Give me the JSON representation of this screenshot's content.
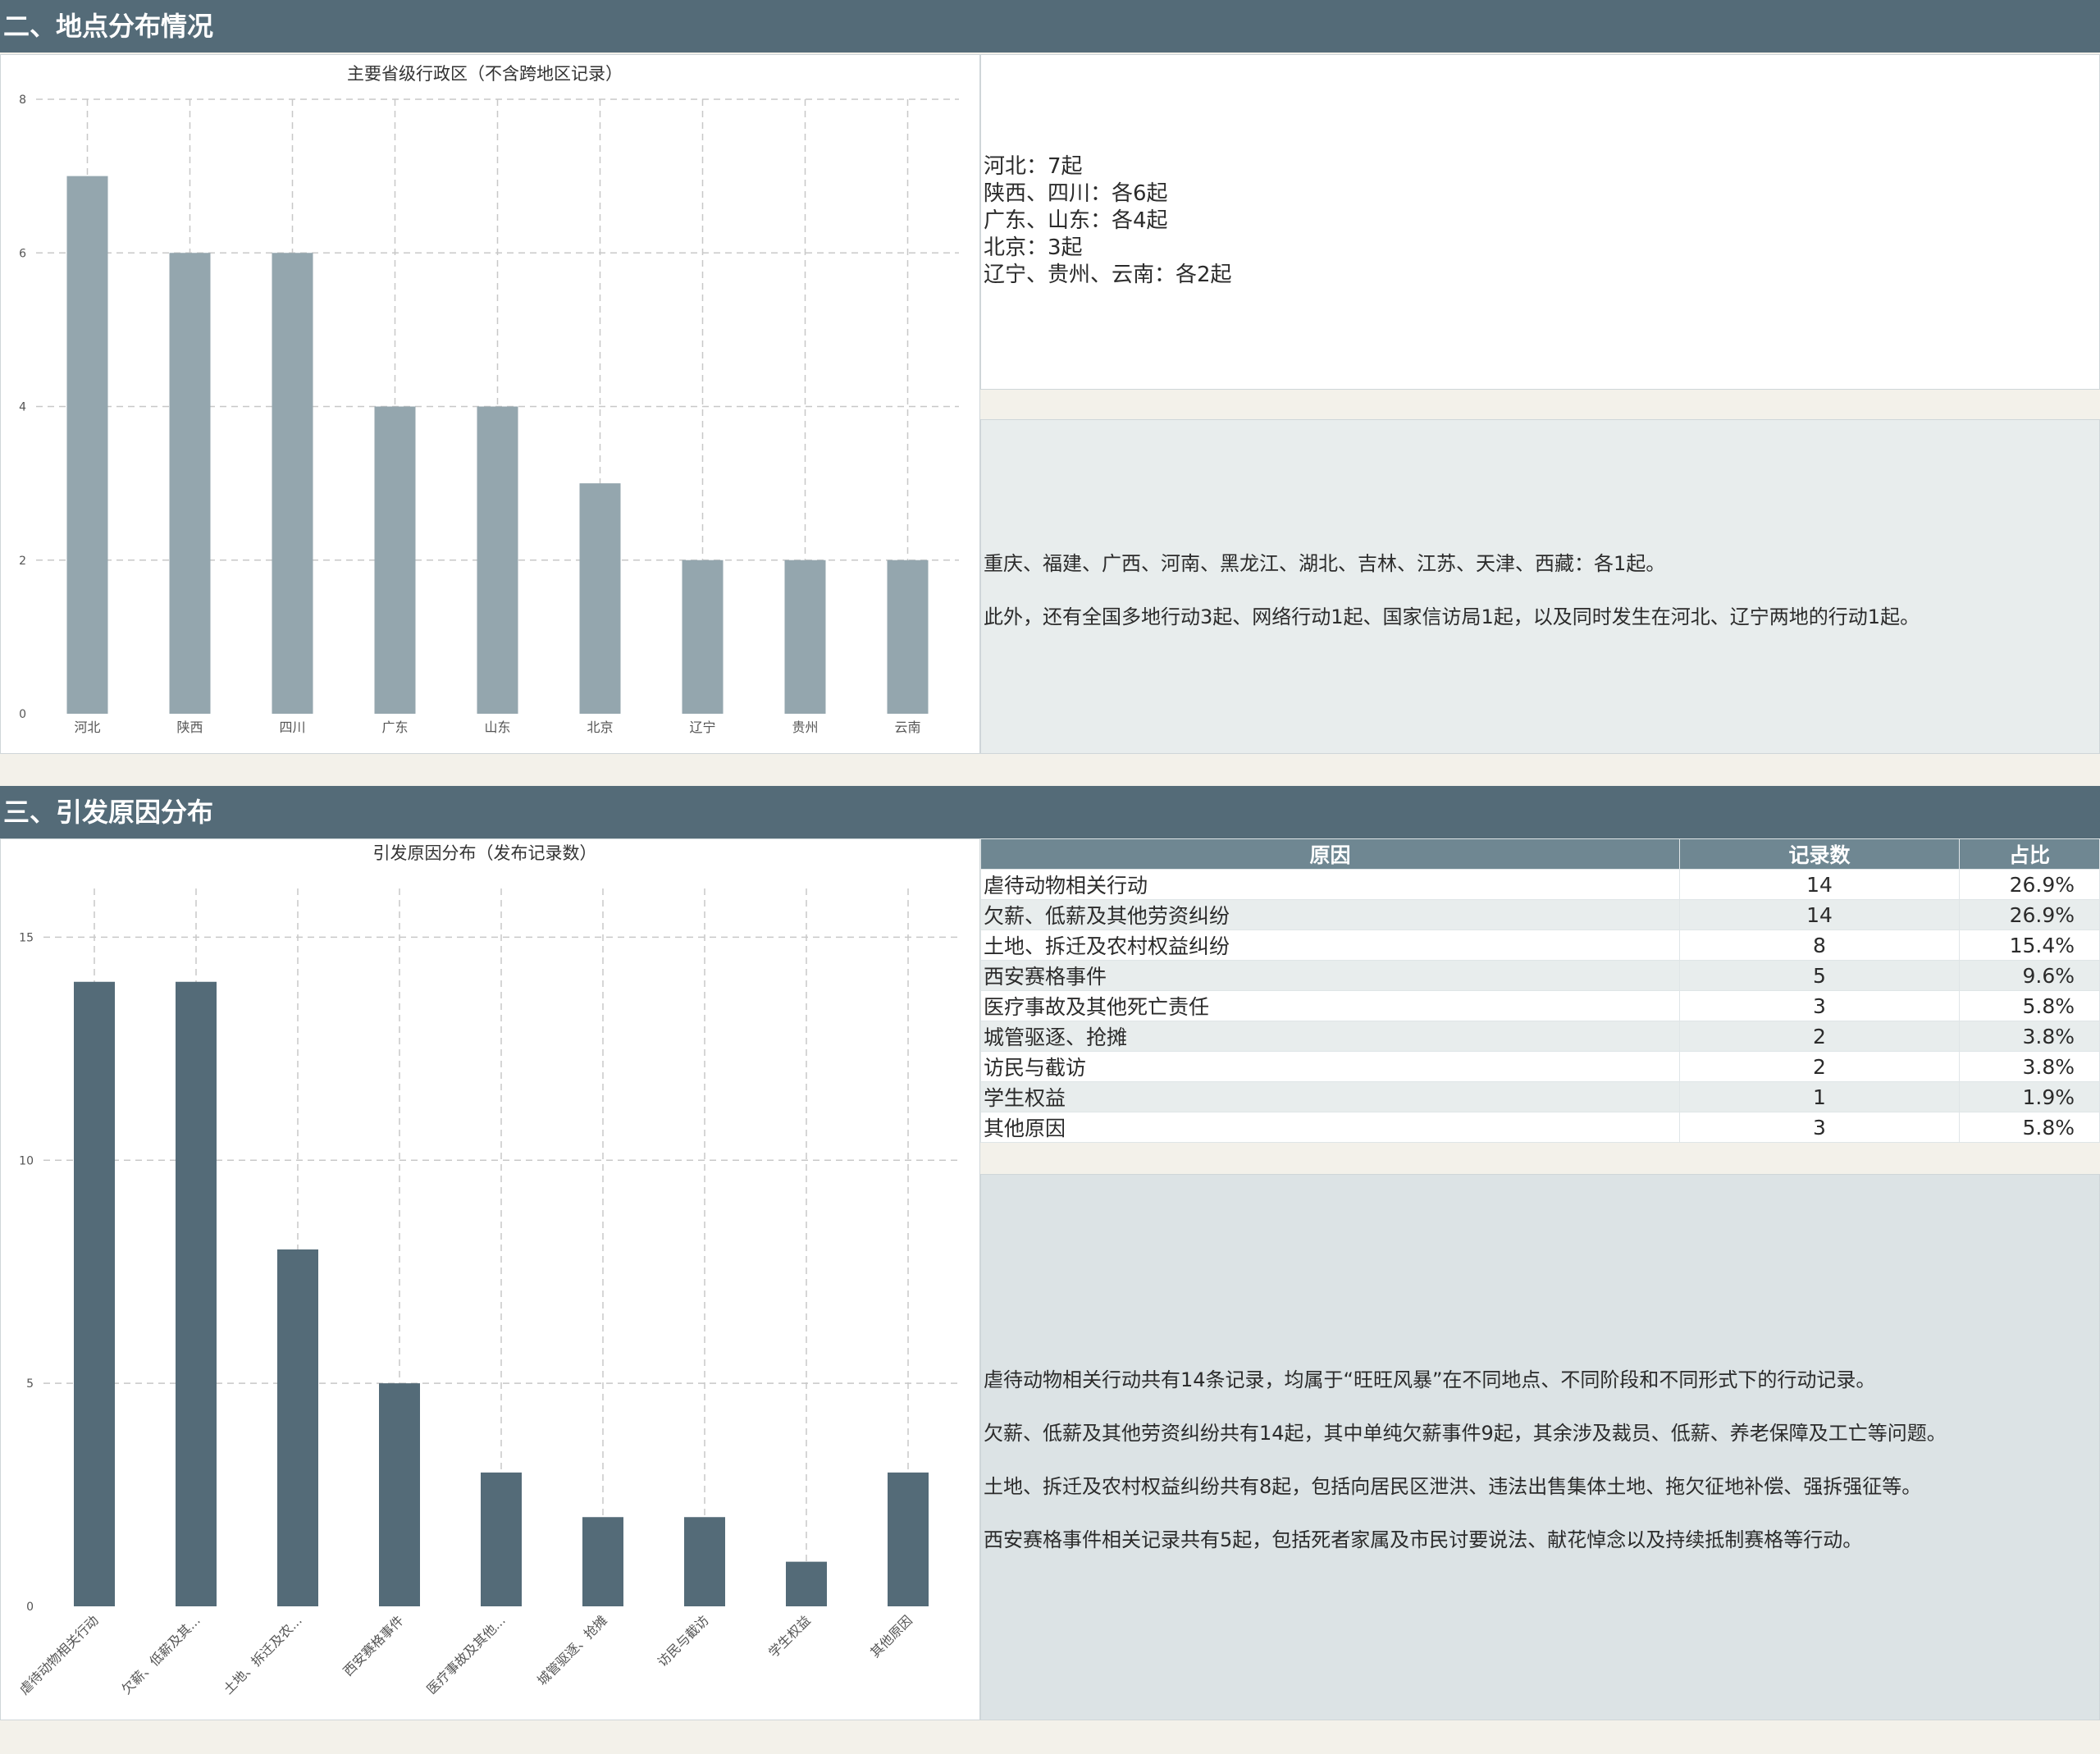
{
  "section2": {
    "title": "二、地点分布情况"
  },
  "section3": {
    "title": "三、引发原因分布"
  },
  "province_summary": [
    "河北：7起",
    "陕西、四川：各6起",
    "广东、山东：各4起",
    "北京：3起",
    "辽宁、贵州、云南：各2起"
  ],
  "province_notes": [
    "重庆、福建、广西、河南、黑龙江、湖北、吉林、江苏、天津、西藏：各1起。",
    "此外，还有全国多地行动3起、网络行动1起、国家信访局1起，以及同时发生在河北、辽宁两地的行动1起。"
  ],
  "cause_table": {
    "headers": [
      "原因",
      "记录数",
      "占比"
    ],
    "rows": [
      [
        "虐待动物相关行动",
        "14",
        "26.9%"
      ],
      [
        "欠薪、低薪及其他劳资纠纷",
        "14",
        "26.9%"
      ],
      [
        "土地、拆迁及农村权益纠纷",
        "8",
        "15.4%"
      ],
      [
        "西安赛格事件",
        "5",
        "9.6%"
      ],
      [
        "医疗事故及其他死亡责任",
        "3",
        "5.8%"
      ],
      [
        "城管驱逐、抢摊",
        "2",
        "3.8%"
      ],
      [
        "访民与截访",
        "2",
        "3.8%"
      ],
      [
        "学生权益",
        "1",
        "1.9%"
      ],
      [
        "其他原因",
        "3",
        "5.8%"
      ]
    ]
  },
  "cause_notes": [
    "虐待动物相关行动共有14条记录，均属于“旺旺风暴”在不同地点、不同阶段和不同形式下的行动记录。",
    "欠薪、低薪及其他劳资纠纷共有14起，其中单纯欠薪事件9起，其余涉及裁员、低薪、养老保障及工亡等问题。",
    "土地、拆迁及农村权益纠纷共有8起，包括向居民区泄洪、违法出售集体土地、拖欠征地补偿、强拆强征等。",
    "西安赛格事件相关记录共有5起，包括死者家属及市民讨要说法、献花悼念以及持续抵制赛格等行动。"
  ],
  "colors": {
    "header": "#546b78",
    "bar_province": "#94a6ae",
    "bar_cause": "#546b78"
  },
  "chart_data": [
    {
      "type": "bar",
      "title": "主要省级行政区（不含跨地区记录）",
      "categories": [
        "河北",
        "陕西",
        "四川",
        "广东",
        "山东",
        "北京",
        "辽宁",
        "贵州",
        "云南"
      ],
      "values": [
        7,
        6,
        6,
        4,
        4,
        3,
        2,
        2,
        2
      ],
      "yticks": [
        0,
        2,
        4,
        6,
        8
      ],
      "ylim": [
        0,
        8
      ],
      "grid": true
    },
    {
      "type": "bar",
      "title": "引发原因分布（发布记录数）",
      "categories": [
        "虐待动物相关行动",
        "欠薪、低薪及其...",
        "土地、拆迁及农...",
        "西安赛格事件",
        "医疗事故及其他...",
        "城管驱逐、抢摊",
        "访民与截访",
        "学生权益",
        "其他原因"
      ],
      "values": [
        14,
        14,
        8,
        5,
        3,
        2,
        2,
        1,
        3
      ],
      "yticks": [
        0,
        5,
        10,
        15
      ],
      "ylim": [
        0,
        16
      ],
      "grid": true
    }
  ]
}
